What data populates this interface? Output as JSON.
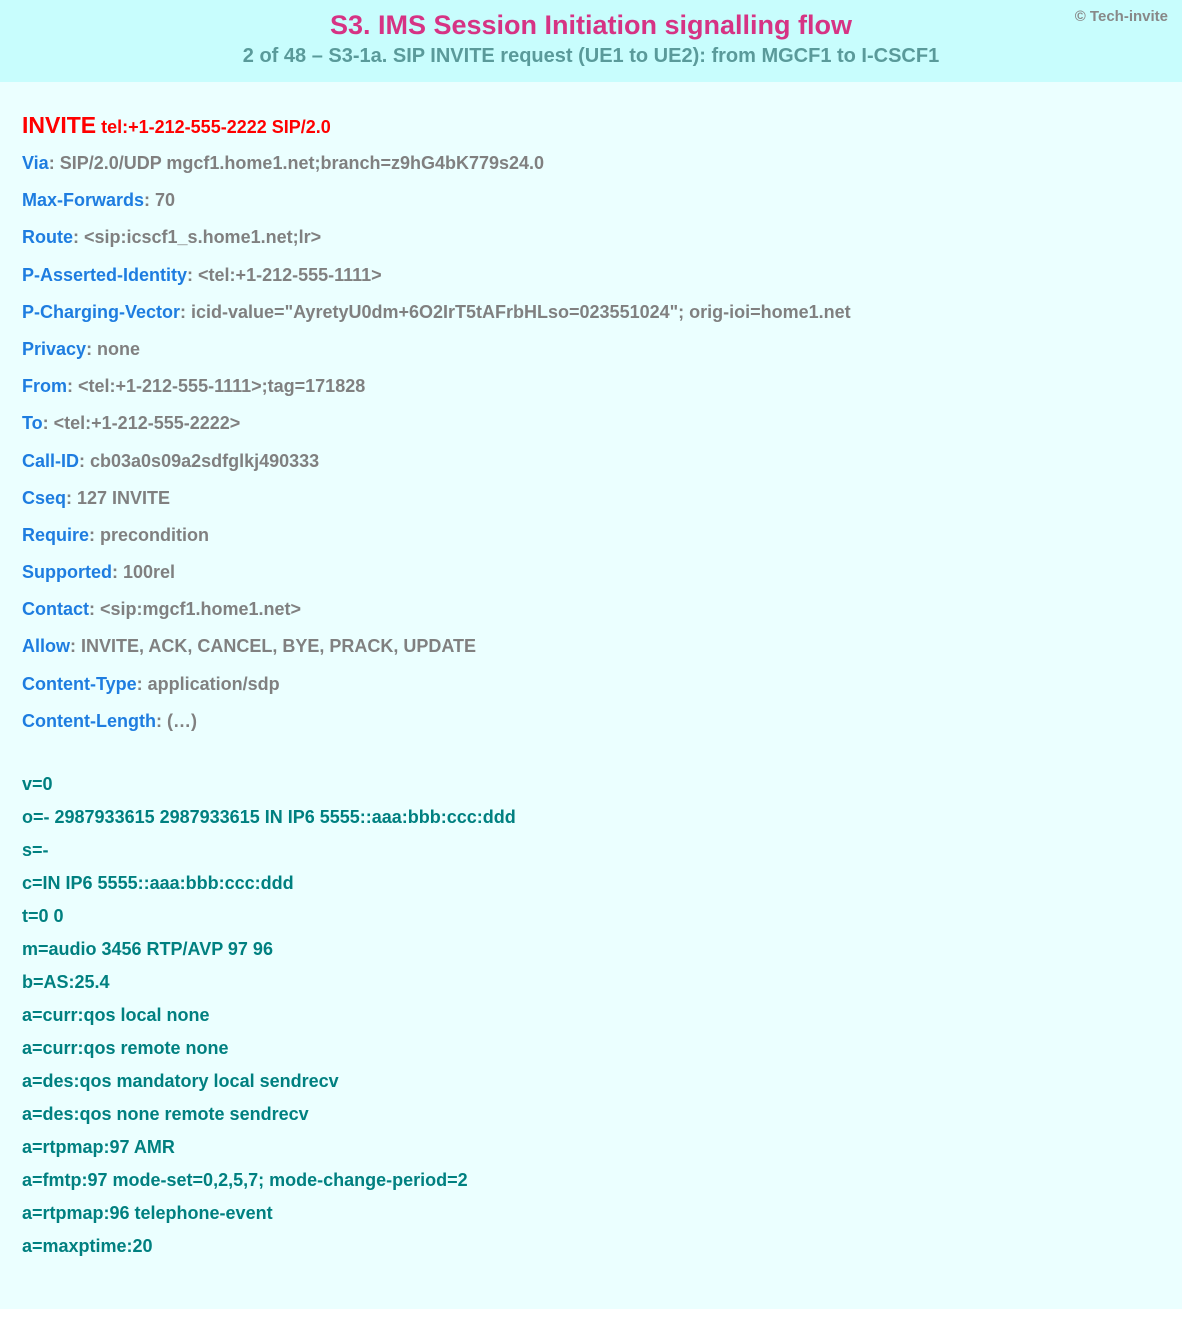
{
  "header": {
    "copyright": "© Tech-invite",
    "title": "S3. IMS Session Initiation signalling flow",
    "subtitle": "2 of 48 – S3-1a. SIP INVITE request (UE1 to UE2): from MGCF1 to I-CSCF1"
  },
  "invite": {
    "method": "INVITE",
    "uri": " tel:+1-212-555-2222 SIP/2.0"
  },
  "sip_headers": [
    {
      "name": "Via",
      "value": ": SIP/2.0/UDP mgcf1.home1.net;branch=z9hG4bK779s24.0"
    },
    {
      "name": "Max-Forwards",
      "value": ": 70"
    },
    {
      "name": "Route",
      "value": ": <sip:icscf1_s.home1.net;lr>"
    },
    {
      "name": "P-Asserted-Identity",
      "value": ": <tel:+1-212-555-1111>"
    },
    {
      "name": "P-Charging-Vector",
      "value": ": icid-value=\"AyretyU0dm+6O2IrT5tAFrbHLso=023551024\"; orig-ioi=home1.net"
    },
    {
      "name": "Privacy",
      "value": ": none"
    },
    {
      "name": "From",
      "value": ": <tel:+1-212-555-1111>;tag=171828"
    },
    {
      "name": "To",
      "value": ": <tel:+1-212-555-2222>"
    },
    {
      "name": "Call-ID",
      "value": ": cb03a0s09a2sdfglkj490333"
    },
    {
      "name": "Cseq",
      "value": ": 127 INVITE"
    },
    {
      "name": "Require",
      "value": ": precondition"
    },
    {
      "name": "Supported",
      "value": ": 100rel"
    },
    {
      "name": "Contact",
      "value": ": <sip:mgcf1.home1.net>"
    },
    {
      "name": "Allow",
      "value": ": INVITE, ACK, CANCEL, BYE, PRACK, UPDATE"
    },
    {
      "name": "Content-Type",
      "value": ": application/sdp"
    },
    {
      "name": "Content-Length",
      "value": ": (…)"
    }
  ],
  "sdp": [
    "v=0",
    "o=- 2987933615 2987933615 IN IP6 5555::aaa:bbb:ccc:ddd",
    "s=-",
    "c=IN IP6 5555::aaa:bbb:ccc:ddd",
    "t=0 0",
    "m=audio 3456 RTP/AVP 97 96",
    "b=AS:25.4",
    "a=curr:qos local none",
    "a=curr:qos remote none",
    "a=des:qos mandatory local sendrecv",
    "a=des:qos none remote sendrecv",
    "a=rtpmap:97 AMR",
    "a=fmtp:97 mode-set=0,2,5,7; mode-change-period=2",
    "a=rtpmap:96 telephone-event",
    "a=maxptime:20"
  ]
}
